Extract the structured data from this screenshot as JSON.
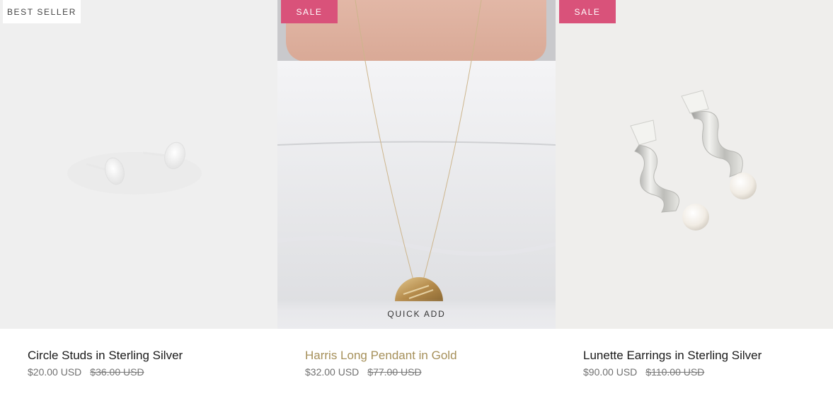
{
  "products": [
    {
      "badge": "BEST SELLER",
      "title": "Circle Studs in Sterling Silver",
      "price": "$20.00 USD",
      "compare_price": "$36.00 USD",
      "image": "silver-circle-stud-earrings"
    },
    {
      "badge": "SALE",
      "title": "Harris Long Pendant in Gold",
      "price": "$32.00 USD",
      "compare_price": "$77.00 USD",
      "quick_add": "QUICK ADD",
      "image": "gold-half-moon-pendant-necklace"
    },
    {
      "badge": "SALE",
      "title": "Lunette Earrings in Sterling Silver",
      "price": "$90.00 USD",
      "compare_price": "$110.00 USD",
      "image": "silver-ribbon-pearl-earrings"
    }
  ],
  "colors": {
    "sale_badge": "#d9527a",
    "hover_title": "#a6905a",
    "price_text": "#707070"
  }
}
